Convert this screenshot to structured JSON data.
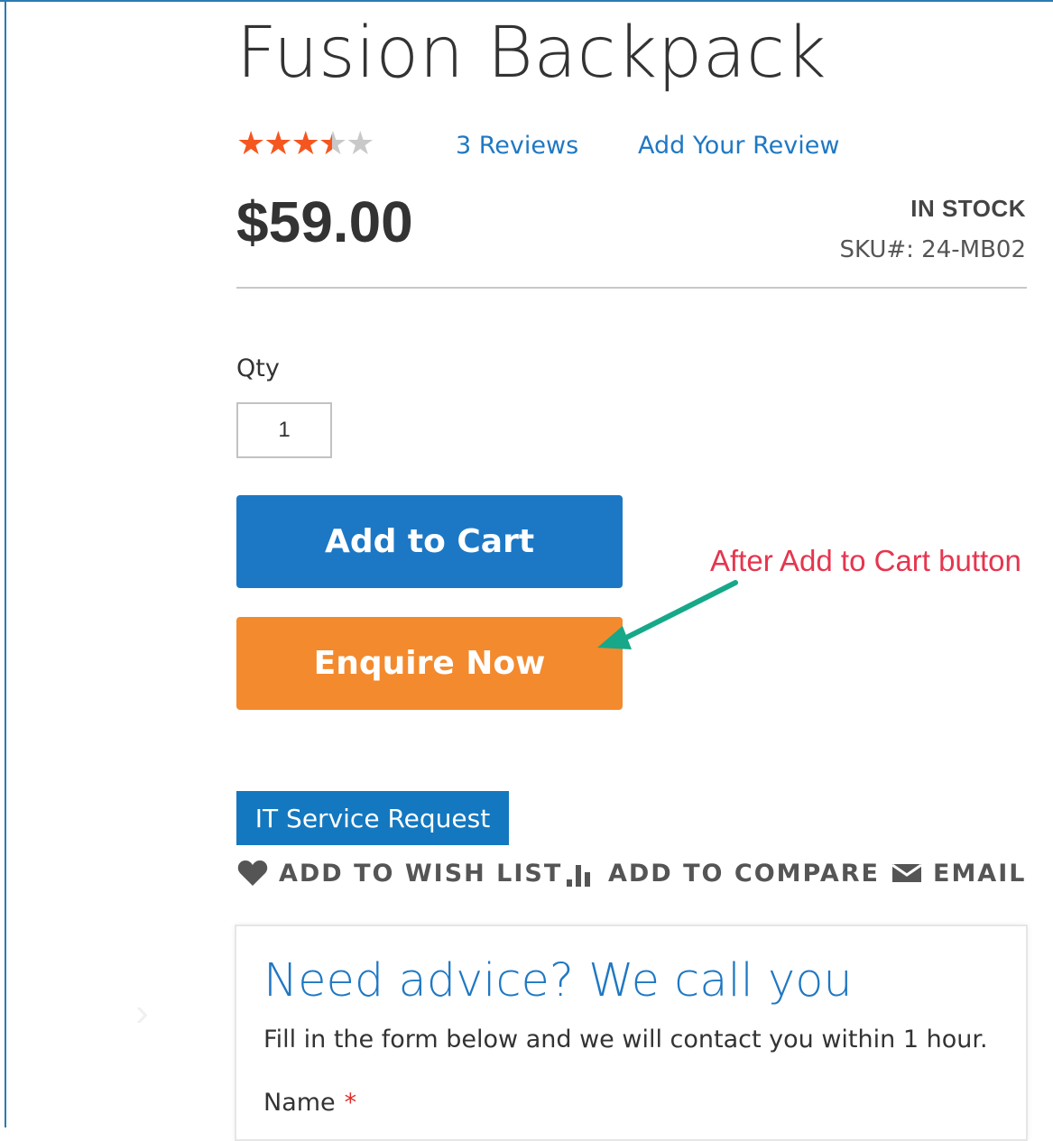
{
  "product": {
    "title": "Fusion Backpack",
    "rating": {
      "stars": [
        {
          "fill": "full"
        },
        {
          "fill": "full"
        },
        {
          "fill": "full"
        },
        {
          "fill": "half"
        },
        {
          "fill": "empty"
        }
      ],
      "reviews_label": "3  Reviews",
      "add_review_label": "Add Your Review"
    },
    "price": "$59.00",
    "stock_status": "IN STOCK",
    "sku": "SKU#:  24-MB02"
  },
  "purchase": {
    "qty_label": "Qty",
    "qty_value": "1",
    "add_to_cart_label": "Add to Cart",
    "enquire_label": "Enquire Now"
  },
  "annotation": {
    "text": "After Add to Cart button",
    "text_color": "#e5364f",
    "arrow_color": "#16a889"
  },
  "it_service": {
    "label": "IT Service Request"
  },
  "actions": {
    "wishlist_label": "ADD TO WISH LIST",
    "compare_label": "ADD TO COMPARE",
    "email_label": "EMAIL",
    "wishlist_icon": "heart-icon",
    "compare_icon": "bar-chart-icon",
    "email_icon": "envelope-icon"
  },
  "advice": {
    "title": "Need advice? We call you",
    "description": "Fill in the form below and we will contact you within 1 hour.",
    "name_label": "Name",
    "required_mark": "*"
  },
  "colors": {
    "accent_blue": "#1c78c5",
    "enquire_orange": "#f38a2e",
    "star_orange": "#f5561f",
    "link_blue": "#1f78c3"
  }
}
